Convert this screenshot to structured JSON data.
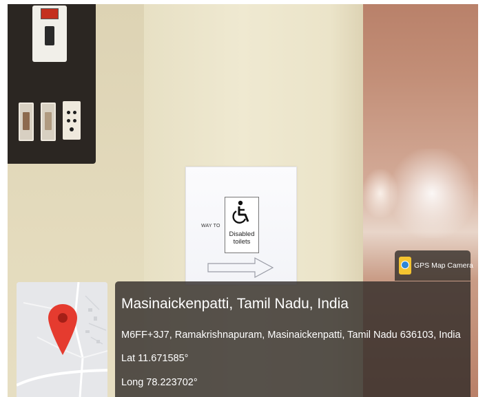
{
  "sign": {
    "direction_text": "WAY TO",
    "label_line1": "Disabled",
    "label_line2": "toilets",
    "icon": "wheelchair-icon"
  },
  "gps_overlay": {
    "brand_label": "GPS Map Camera",
    "brand_icon": "gps-map-camera-icon",
    "place_title": "Masinaickenpatti, Tamil Nadu, India",
    "address": "M6FF+3J7, Ramakrishnapuram, Masinaickenpatti, Tamil Nadu 636103, India",
    "latitude": "Lat 11.671585°",
    "longitude": "Long 78.223702°",
    "map_pin_icon": "map-pin-icon",
    "pin_color": "#e53b2f"
  }
}
